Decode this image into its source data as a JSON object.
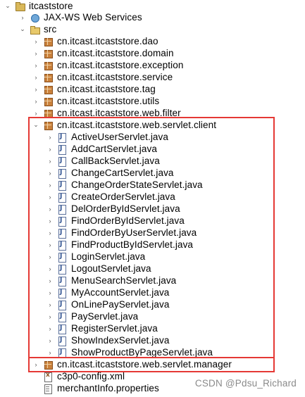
{
  "tree": {
    "project": {
      "label": "itcaststore",
      "expanded": true
    },
    "jaxws": {
      "label": "JAX-WS Web Services"
    },
    "src_folder": {
      "label": "src",
      "expanded": true
    },
    "packages": [
      {
        "label": "cn.itcast.itcaststore.dao"
      },
      {
        "label": "cn.itcast.itcaststore.domain"
      },
      {
        "label": "cn.itcast.itcaststore.exception"
      },
      {
        "label": "cn.itcast.itcaststore.service"
      },
      {
        "label": "cn.itcast.itcaststore.tag"
      },
      {
        "label": "cn.itcast.itcaststore.utils"
      },
      {
        "label": "cn.itcast.itcaststore.web.filter"
      }
    ],
    "client_package": {
      "label": "cn.itcast.itcaststore.web.servlet.client",
      "expanded": true
    },
    "client_files": [
      {
        "label": "ActiveUserServlet.java"
      },
      {
        "label": "AddCartServlet.java"
      },
      {
        "label": "CallBackServlet.java"
      },
      {
        "label": "ChangeCartServlet.java"
      },
      {
        "label": "ChangeOrderStateServlet.java"
      },
      {
        "label": "CreateOrderServlet.java"
      },
      {
        "label": "DelOrderByIdServlet.java"
      },
      {
        "label": "FindOrderByIdServlet.java"
      },
      {
        "label": "FindOrderByUserServlet.java"
      },
      {
        "label": "FindProductByIdServlet.java"
      },
      {
        "label": "LoginServlet.java"
      },
      {
        "label": "LogoutServlet.java"
      },
      {
        "label": "MenuSearchServlet.java"
      },
      {
        "label": "MyAccountServlet.java"
      },
      {
        "label": "OnLinePayServlet.java"
      },
      {
        "label": "PayServlet.java"
      },
      {
        "label": "RegisterServlet.java"
      },
      {
        "label": "ShowIndexServlet.java"
      },
      {
        "label": "ShowProductByPageServlet.java"
      }
    ],
    "manager_package": {
      "label": "cn.itcast.itcaststore.web.servlet.manager"
    },
    "files": [
      {
        "label": "c3p0-config.xml"
      },
      {
        "label": "merchantInfo.properties"
      }
    ]
  },
  "watermark": "CSDN @Pdsu_Richard",
  "colors": {
    "highlight_border": "#e53935"
  }
}
